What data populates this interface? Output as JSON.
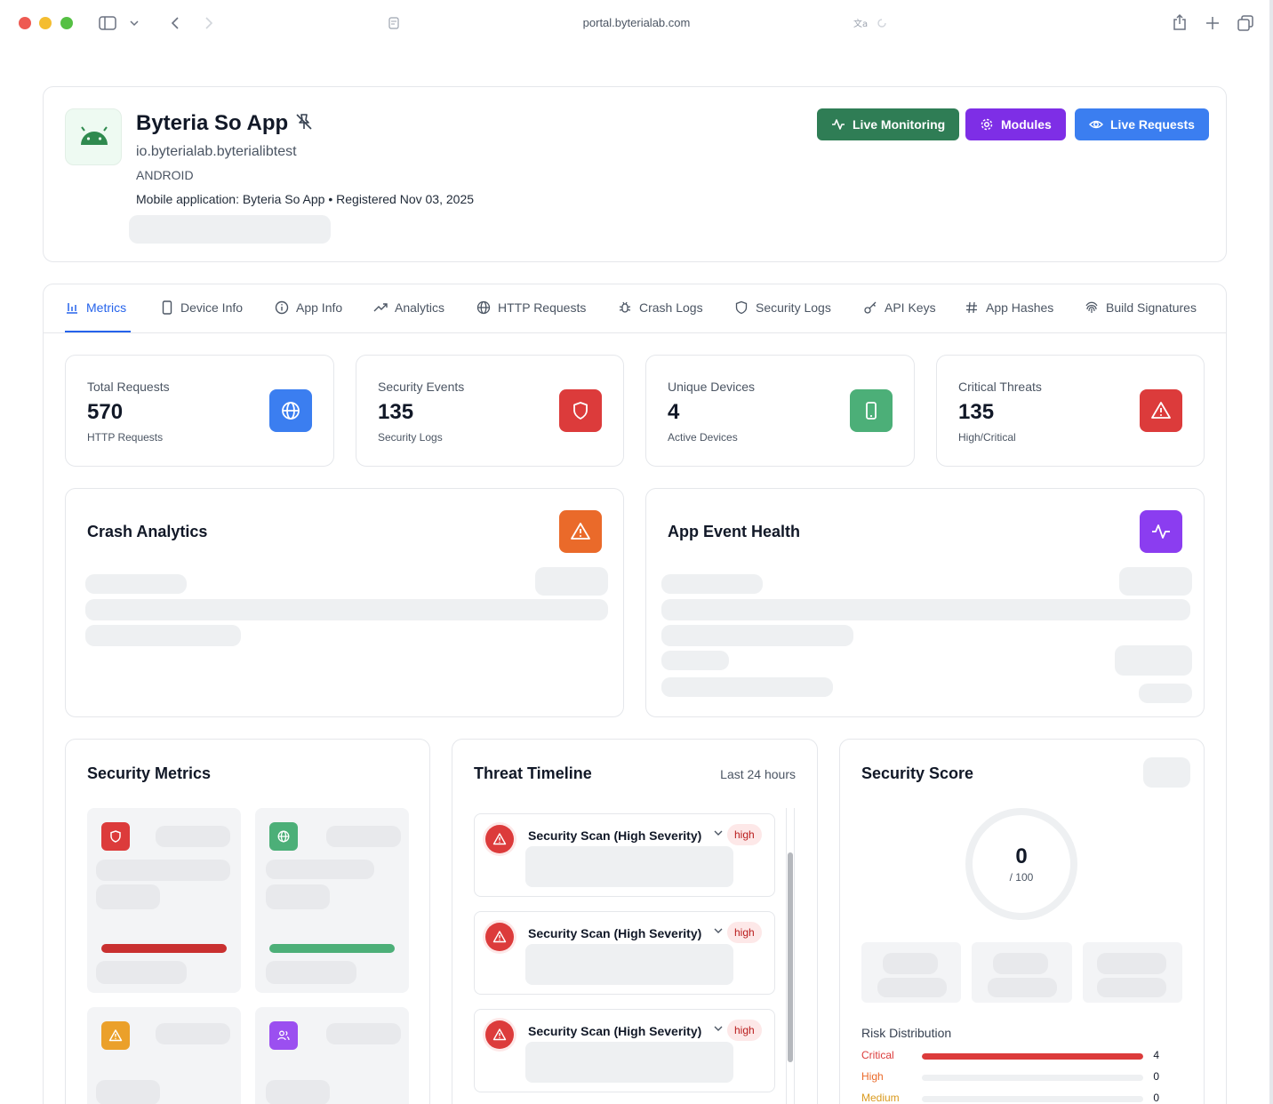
{
  "browser": {
    "url": "portal.byterialab.com"
  },
  "header": {
    "title": "Byteria So App",
    "package": "io.byterialab.byterialibtest",
    "platform": "ANDROID",
    "description": "Mobile application: Byteria So App • Registered Nov 03, 2025",
    "buttons": {
      "live_monitoring": "Live Monitoring",
      "modules": "Modules",
      "live_requests": "Live Requests"
    }
  },
  "tabs": [
    {
      "label": "Metrics",
      "icon": "bar-chart-icon"
    },
    {
      "label": "Device Info",
      "icon": "smartphone-icon"
    },
    {
      "label": "App Info",
      "icon": "info-icon"
    },
    {
      "label": "Analytics",
      "icon": "trending-up-icon"
    },
    {
      "label": "HTTP Requests",
      "icon": "globe-icon"
    },
    {
      "label": "Crash Logs",
      "icon": "bug-icon"
    },
    {
      "label": "Security Logs",
      "icon": "shield-icon"
    },
    {
      "label": "API Keys",
      "icon": "key-icon"
    },
    {
      "label": "App Hashes",
      "icon": "hash-icon"
    },
    {
      "label": "Build Signatures",
      "icon": "fingerprint-icon"
    }
  ],
  "stats": [
    {
      "label": "Total Requests",
      "value": "570",
      "sub": "HTTP Requests",
      "color": "#3b82f6"
    },
    {
      "label": "Security Events",
      "value": "135",
      "sub": "Security Logs",
      "color": "#dc3b3b"
    },
    {
      "label": "Unique Devices",
      "value": "4",
      "sub": "Active Devices",
      "color": "#4caf78"
    },
    {
      "label": "Critical Threats",
      "value": "135",
      "sub": "High/Critical",
      "color": "#dc3b3b"
    }
  ],
  "crash": {
    "title": "Crash Analytics",
    "color": "#ea6a2a"
  },
  "event_health": {
    "title": "App Event Health",
    "color": "#8b3df0"
  },
  "security_metrics": {
    "title": "Security Metrics"
  },
  "timeline": {
    "title": "Threat Timeline",
    "range": "Last 24 hours",
    "items": [
      {
        "title": "Security Scan (High Severity)",
        "severity": "high"
      },
      {
        "title": "Security Scan (High Severity)",
        "severity": "high"
      },
      {
        "title": "Security Scan (High Severity)",
        "severity": "high"
      }
    ]
  },
  "score": {
    "title": "Security Score",
    "value": "0",
    "max": "/ 100",
    "risk_title": "Risk Distribution",
    "risks": [
      {
        "label": "Critical",
        "count": "4",
        "fraction": 1.0,
        "color": "#dc3b3b"
      },
      {
        "label": "High",
        "count": "0",
        "fraction": 0,
        "color": "#ea6a2a"
      },
      {
        "label": "Medium",
        "count": "0",
        "fraction": 0,
        "color": "#d99a1e"
      }
    ]
  }
}
